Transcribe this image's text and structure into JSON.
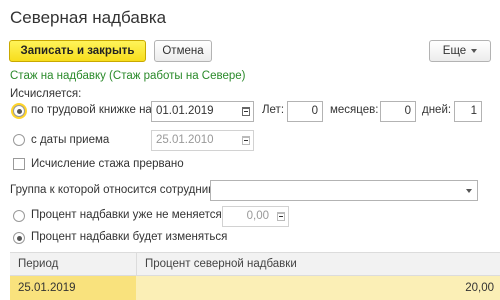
{
  "window": {
    "title": "Северная надбавка"
  },
  "toolbar": {
    "save_close": "Записать и закрыть",
    "cancel": "Отмена",
    "more": "Еще"
  },
  "form": {
    "experience_link": "Стаж на надбавку (Стаж работы на Севере)",
    "calculated_label": "Исчисляется:",
    "option_workbook": {
      "label": "по трудовой книжке на",
      "date": "01.01.2019",
      "years_label": "Лет:",
      "years": "0",
      "months_label": "месяцев:",
      "months": "0",
      "days_label": "дней:",
      "days": "1",
      "selected": true
    },
    "option_hire": {
      "label": "с даты приема",
      "date": "25.01.2010",
      "selected": false
    },
    "interrupted": {
      "label": "Исчисление стажа прервано",
      "checked": false
    },
    "group_label": "Группа к которой относится сотрудник:",
    "group_value": "",
    "percent_fixed": {
      "label": "Процент надбавки уже не меняется",
      "value": "0,00",
      "selected": false
    },
    "percent_changing": {
      "label": "Процент надбавки будет изменяться",
      "selected": true
    }
  },
  "table": {
    "columns": [
      "Период",
      "Процент северной надбавки"
    ],
    "rows": [
      {
        "period": "25.01.2019",
        "percent": "20,00"
      }
    ]
  },
  "colors": {
    "primary_button": "#f7dd1c",
    "link_green": "#2a8a2a",
    "selected_row": "#fbefb6"
  },
  "icons": [
    "calendar-icon",
    "chevron-down-icon"
  ]
}
